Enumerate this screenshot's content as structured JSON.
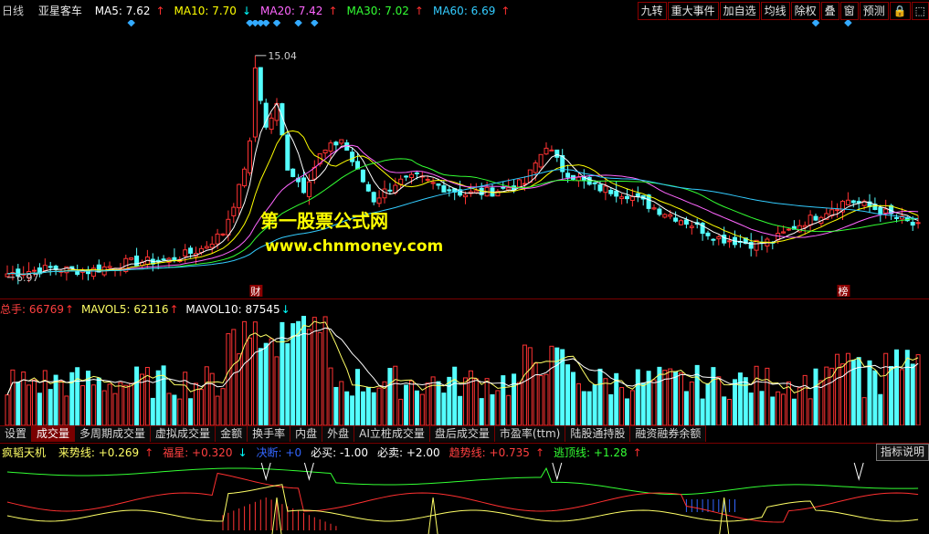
{
  "header": {
    "period": "日线",
    "stock_name": "亚星客车",
    "ma": [
      {
        "label": "MA5: 7.62",
        "arrow": "↑",
        "color": "#ffffff",
        "arrow_color": "#ff3030"
      },
      {
        "label": "MA10: 7.70",
        "arrow": "↓",
        "color": "#ffff00",
        "arrow_color": "#00ffff"
      },
      {
        "label": "MA20: 7.42",
        "arrow": "↑",
        "color": "#ff66ff",
        "arrow_color": "#ff3030"
      },
      {
        "label": "MA30: 7.02",
        "arrow": "↑",
        "color": "#33ff33",
        "arrow_color": "#ff3030"
      },
      {
        "label": "MA60: 6.69",
        "arrow": "↑",
        "color": "#33ccff",
        "arrow_color": "#ff3030"
      }
    ]
  },
  "toolbar": {
    "buttons": [
      "九转",
      "重大事件",
      "加自选",
      "均线",
      "除权",
      "叠",
      "窗",
      "预测",
      "🔒",
      "⬚"
    ]
  },
  "price_chart": {
    "high_label": "15.04",
    "low_label": "6.97",
    "marker_cai": "财",
    "marker_bang": "榜",
    "watermark_title": "第一股票公式网",
    "watermark_url": "www.chnmoney.com"
  },
  "volume_header": {
    "total_label": "总手: 66769",
    "total_arrow": "↑",
    "mavol5_label": "MAVOL5: 62116",
    "mavol5_arrow": "↑",
    "mavol10_label": "MAVOL10: 87545",
    "mavol10_arrow": "↓"
  },
  "tabs": [
    "设置",
    "成交量",
    "多周期成交量",
    "虚拟成交量",
    "金额",
    "换手率",
    "内盘",
    "外盘",
    "AI立桩成交量",
    "盘后成交量",
    "市盈率(ttm)",
    "陆股通持股",
    "融资融券余额"
  ],
  "active_tab": 1,
  "indicator_header": {
    "name": "疯韬天机",
    "items": [
      {
        "label": "来势线: +0.269",
        "arrow": "↑",
        "color": "#ffff66",
        "arrow_color": "#ff3030"
      },
      {
        "label": "福星: +0.320",
        "arrow": "↓",
        "color": "#ff4040",
        "arrow_color": "#00ffff"
      },
      {
        "label": "决断: +0",
        "arrow": "",
        "color": "#3366ff",
        "arrow_color": ""
      },
      {
        "label": "必买: -1.00",
        "arrow": "",
        "color": "#ffffff",
        "arrow_color": ""
      },
      {
        "label": "必卖: +2.00",
        "arrow": "",
        "color": "#ffffff",
        "arrow_color": ""
      },
      {
        "label": "趋势线: +0.735",
        "arrow": "↑",
        "color": "#ff4040",
        "arrow_color": "#ff3030"
      },
      {
        "label": "逃顶线: +1.28",
        "arrow": "↑",
        "color": "#33ff33",
        "arrow_color": "#ff3030"
      }
    ],
    "explain_button": "指标说明"
  },
  "colors": {
    "up": "#ff3333",
    "down": "#54ffff",
    "grid": "#7a0000",
    "ma5": "#ffffff",
    "ma10": "#ffff00",
    "ma20": "#ff66ff",
    "ma30": "#33ff33",
    "ma60": "#33ccff"
  }
}
